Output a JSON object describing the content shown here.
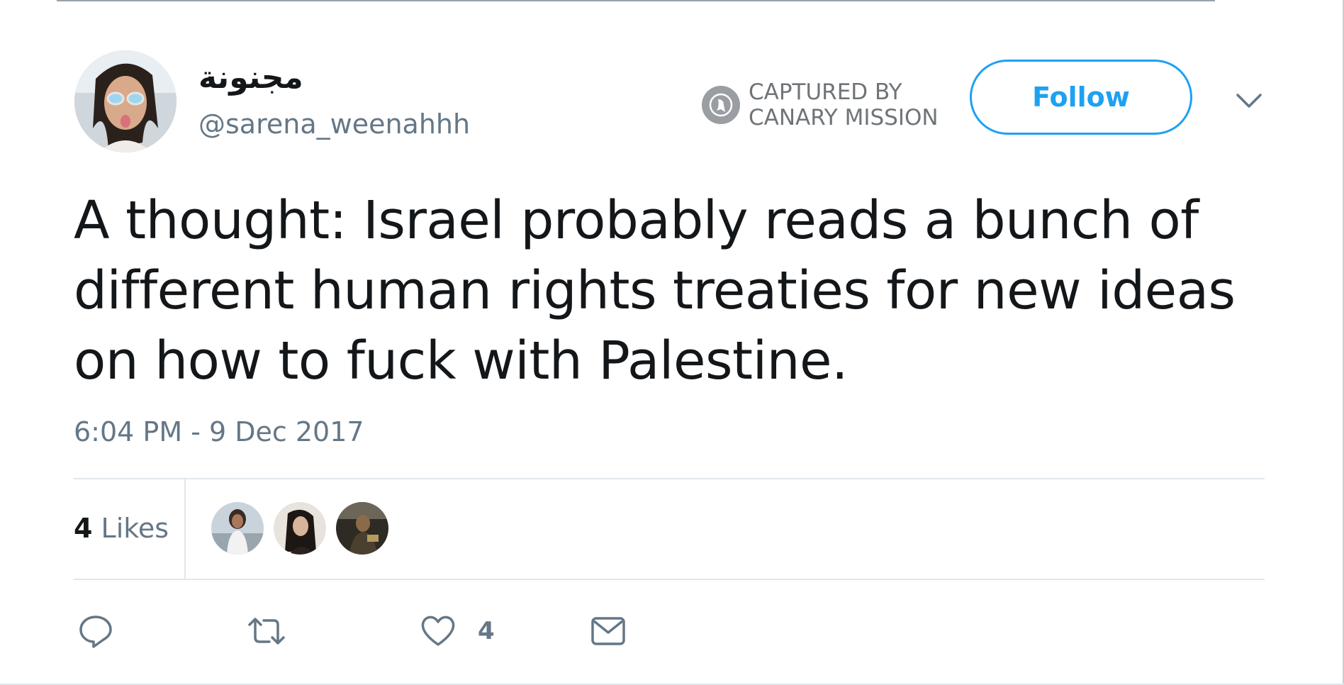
{
  "user": {
    "display_name": "مجنونة",
    "handle": "@sarena_weenahhh",
    "avatar_desc": "avatar"
  },
  "badge": {
    "line1": "CAPTURED BY",
    "line2": "CANARY MISSION",
    "icon": "canary-bird-icon"
  },
  "header": {
    "follow_label": "Follow",
    "more_icon": "chevron-down-icon"
  },
  "tweet": {
    "text": "A thought: Israel probably reads a bunch of different human rights treaties for new ideas on how to fuck with Palestine.",
    "timestamp": "6:04 PM - 9 Dec 2017"
  },
  "stats": {
    "likes_count": "4",
    "likes_label": "Likes",
    "likers": [
      {
        "name": "liker-1"
      },
      {
        "name": "liker-2"
      },
      {
        "name": "liker-3"
      }
    ]
  },
  "actions": {
    "reply_icon": "reply-icon",
    "retweet_icon": "retweet-icon",
    "like_icon": "heart-icon",
    "like_count": "4",
    "dm_icon": "envelope-icon"
  },
  "colors": {
    "accent": "#1da1f2",
    "text": "#14171a",
    "muted": "#657786",
    "divider": "#e1e8ed"
  }
}
